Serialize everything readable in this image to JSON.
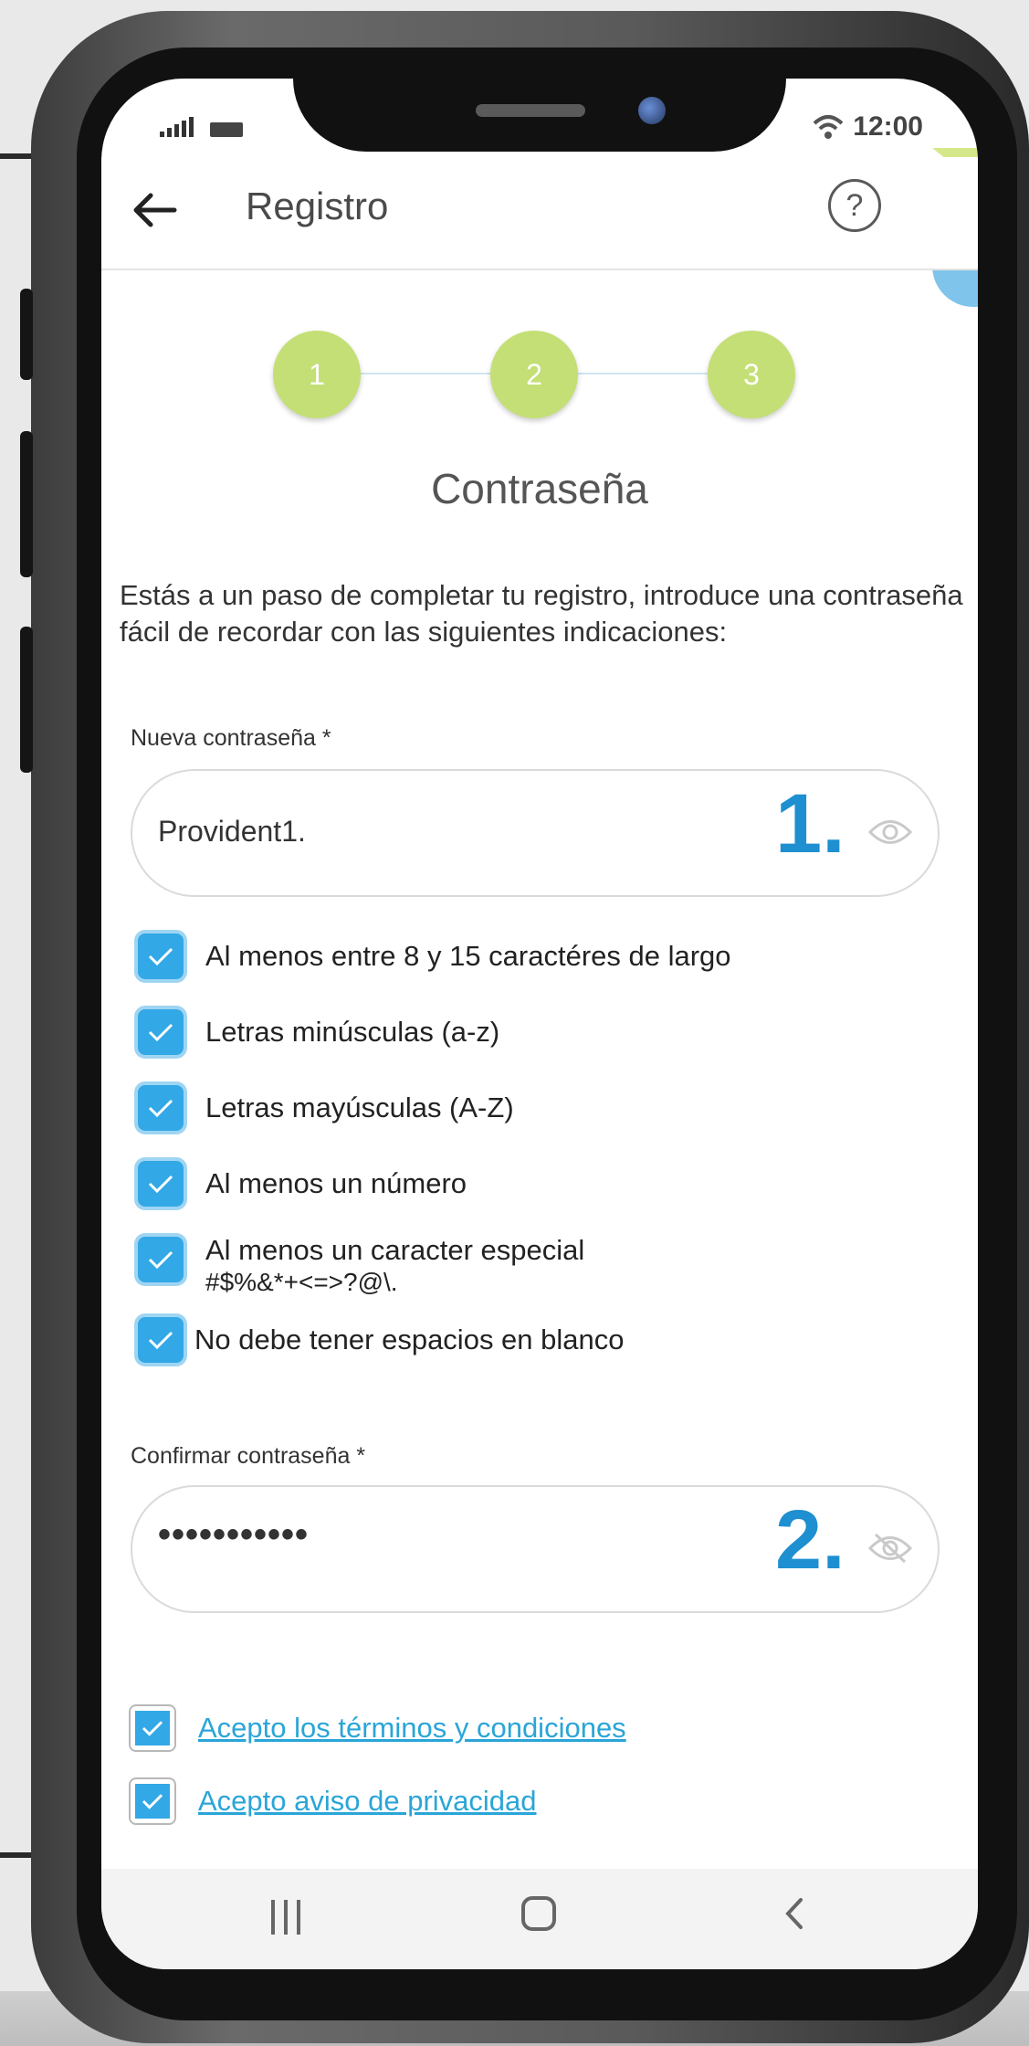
{
  "status": {
    "time": "12:00",
    "wifi_icon": "wifi-icon",
    "signal_icon": "signal-bars-icon",
    "battery_icon": "battery-icon"
  },
  "appbar": {
    "title": "Registro",
    "back_icon": "arrow-left-icon",
    "help_icon": "question-circle-icon",
    "help_glyph": "?"
  },
  "stepper": {
    "steps": [
      "1",
      "2",
      "3"
    ]
  },
  "section_title": "Contraseña",
  "intro": "Estás a un paso de completar tu registro, introduce una contraseña fácil de recordar con las siguientes indicaciones:",
  "new_password": {
    "label": "Nueva contraseña *",
    "value": "Provident1.",
    "marker": "1.",
    "visibility_icon": "eye-icon"
  },
  "requirements": [
    {
      "text": "Al menos entre 8 y 15 caractéres de largo",
      "checked": true
    },
    {
      "text": "Letras minúsculas (a-z)",
      "checked": true
    },
    {
      "text": "Letras mayúsculas (A-Z)",
      "checked": true
    },
    {
      "text": "Al menos un número",
      "checked": true
    },
    {
      "text": "Al menos un caracter especial",
      "text2": "#$%&*+<=>?@\\.",
      "checked": true
    },
    {
      "text": "No debe tener espacios en blanco",
      "checked": true
    }
  ],
  "confirm_password": {
    "label": "Confirmar contraseña *",
    "masked_value": "•••••••••••",
    "marker": "2.",
    "visibility_icon": "eye-off-icon"
  },
  "legal": {
    "terms": {
      "label": "Acepto los términos y condiciones",
      "checked": true
    },
    "privacy": {
      "label": "Acepto aviso de privacidad",
      "checked": true
    }
  },
  "colors": {
    "accent": "#32a8e6",
    "step": "#c4df75",
    "marker": "#1e8fd0",
    "link": "#2aa5d8"
  },
  "navbar": {
    "recent_icon": "recent-apps-icon",
    "home_icon": "home-icon",
    "back_icon": "nav-back-icon"
  }
}
